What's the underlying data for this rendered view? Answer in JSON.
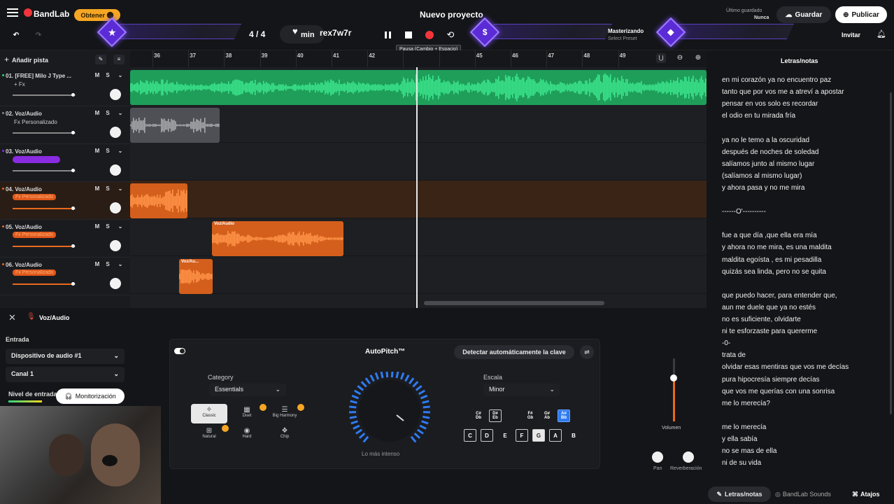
{
  "header": {
    "logo": "BandLab",
    "get_pill": "Obtener",
    "project_title": "Nuevo proyecto",
    "last_saved_label": "Último guardado",
    "last_saved_value": "Nunca",
    "save_label": "Guardar",
    "publish_label": "Publicar",
    "invite_label": "Invitar",
    "time_signature": "4 / 4",
    "minutes": "min",
    "key_text": "rex7w7r",
    "mastering_label": "Masterizando",
    "mastering_preset": "Select Preset",
    "tooltip": "Pausa (Cambio + Espacio)"
  },
  "tracks_panel": {
    "add_track": "Añadir pista",
    "tracks": [
      {
        "name": "01. [FREE] Milo J Type ...",
        "fx": "+ Fx",
        "fx_style": "plain",
        "mute": "M",
        "solo": "S",
        "color": "#2ed47a",
        "level": 0.95
      },
      {
        "name": "02. Voz/Audio",
        "fx": "Fx Personalizado",
        "fx_style": "plain",
        "mute": "M",
        "solo": "S",
        "color": "#888888",
        "level": 0.95
      },
      {
        "name": "03. Voz/Audio",
        "fx": "",
        "fx_style": "purple",
        "mute": "M",
        "solo": "S",
        "color": "#8a2be2",
        "level": 0.95
      },
      {
        "name": "04. Voz/Audio",
        "fx": "Fx Personalizado",
        "fx_style": "orange",
        "mute": "M",
        "solo": "S",
        "color": "#e86a1e",
        "level": 0.95
      },
      {
        "name": "05. Voz/Audio",
        "fx": "Fx Personalizado",
        "fx_style": "orange",
        "mute": "M",
        "solo": "S",
        "color": "#e86a1e",
        "level": 0.95
      },
      {
        "name": "06. Voz/Audio",
        "fx": "Fx Personalizado",
        "fx_style": "orange",
        "mute": "M",
        "solo": "S",
        "color": "#e86a1e",
        "level": 0.95
      }
    ]
  },
  "ruler": {
    "bars": [
      "36",
      "37",
      "38",
      "39",
      "40",
      "41",
      "42",
      "",
      "",
      "45",
      "46",
      "47",
      "48",
      "49"
    ]
  },
  "clips": {
    "clip5": "Voz/Audio",
    "clip6": "Voz/Au..."
  },
  "bottom": {
    "track_title": "Voz/Audio",
    "input_label": "Entrada",
    "device": "Dispositivo de audio #1",
    "channel": "Canal 1",
    "input_level_label": "Nivel de entrada",
    "monitoring": "Monitorización"
  },
  "autopitch": {
    "title": "AutoPitch™",
    "detect_key": "Detectar automáticamente la clave",
    "category_label": "Category",
    "category_value": "Essentials",
    "presets": [
      "Classic",
      "Duet",
      "Big Harmony",
      "Natural",
      "Hard",
      "Chip"
    ],
    "intensity_label": "Lo más intenso",
    "scale_label": "Escala",
    "scale_value": "Minor",
    "sharps": [
      "C#\nDb",
      "D#\nEb",
      "F#\nGb",
      "G#\nAb",
      "A#\nBb"
    ],
    "naturals": [
      "C",
      "D",
      "E",
      "F",
      "G",
      "A",
      "B"
    ]
  },
  "mixer": {
    "volume_label": "Volumen",
    "pan_label": "Pan",
    "reverb_label": "Reverberación"
  },
  "lyrics": {
    "title": "Letras/notas",
    "lines": [
      "en mi corazón ya no encuentro paz",
      "tanto que por vos me a  atreví a apostar",
      "pensar en vos solo es recordar",
      "el odio en tu mirada fría",
      "",
      "ya no le temo a la oscuridad",
      "después de noches de soledad",
      "salíamos junto  al  mismo lugar",
      "(salíamos al mismo lugar)",
      "y ahora pasa y no me mira",
      "",
      "------O'----------",
      "",
      "fue a que día ,que ella era mía",
      "y ahora no me mira, es una maldita",
      "maldita egoísta , es mi pesadilla",
      "quizás sea linda, pero no se quita",
      "",
      "que puedo hacer, para entender que,",
      "aun me duele que ya no estés",
      "no es suficiente, olvidarte",
      "ni te esforzaste para quererme",
      "-0-",
      "trata de",
      "olvidar esas mentiras que vos me decías",
      "pura hipocresía siempre decías",
      "que vos me querías con una sonrisa",
      "me lo merecía?",
      "",
      "me lo merecía",
      "y ella sabía",
      "no se mas de ella",
      "ni de su vida"
    ]
  },
  "footer": {
    "lyrics_tab": "Letras/notas",
    "sounds_tab": "BandLab Sounds",
    "shortcuts_tab": "Atajos"
  }
}
